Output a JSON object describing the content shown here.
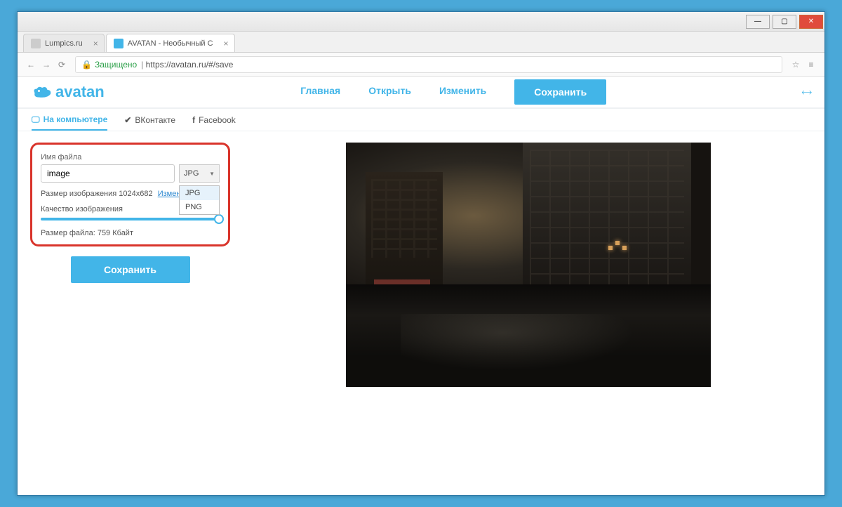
{
  "browser": {
    "tabs": [
      {
        "title": "Lumpics.ru"
      },
      {
        "title": "AVATAN - Необычный С"
      }
    ],
    "secure_label": "Защищено",
    "url_prefix": "https://",
    "url_rest": "avatan.ru/#/save"
  },
  "site": {
    "logo_text": "avatan",
    "nav": {
      "home": "Главная",
      "open": "Открыть",
      "edit": "Изменить",
      "save": "Сохранить"
    },
    "subnav": {
      "computer": "На компьютере",
      "vk": "ВКонтакте",
      "fb": "Facebook"
    }
  },
  "panel": {
    "filename_label": "Имя файла",
    "filename_value": "image",
    "format_selected": "JPG",
    "format_options": {
      "opt1": "JPG",
      "opt2": "PNG"
    },
    "dimensions_label": "Размер изображения 1024x682",
    "change_link": "Изменить",
    "quality_label": "Качество изображения",
    "quality_value": "10",
    "filesize_label": "Размер файла: 759 Кбайт",
    "save_button": "Сохранить"
  }
}
